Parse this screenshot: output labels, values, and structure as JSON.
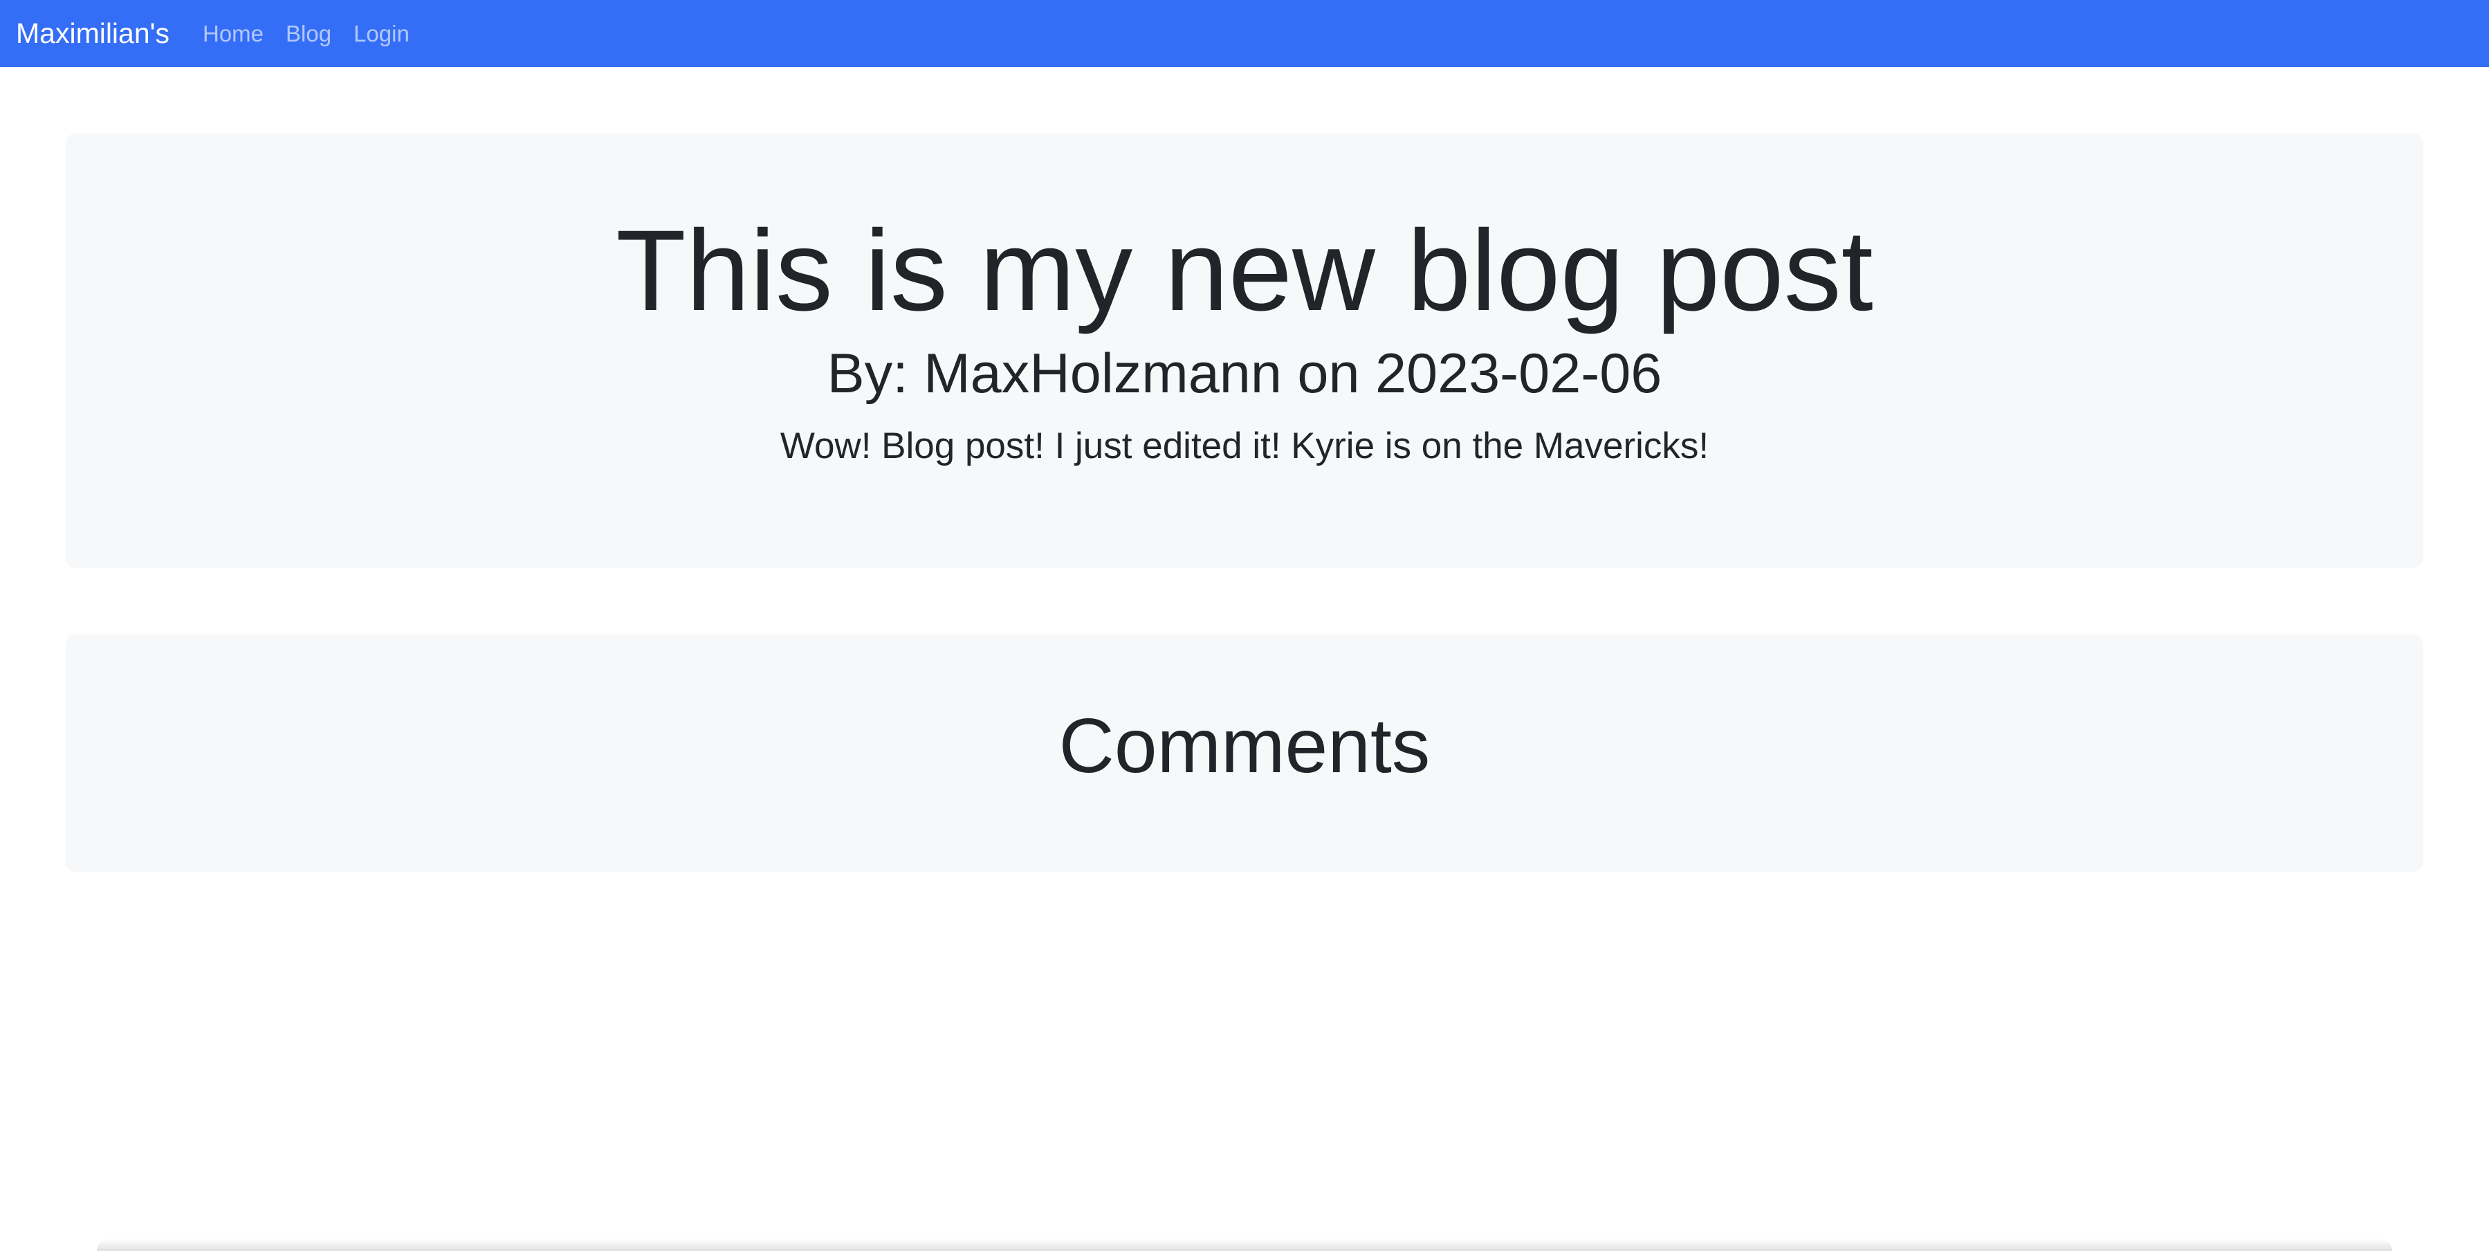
{
  "navbar": {
    "brand": "Maximilian's",
    "links": [
      {
        "label": "Home"
      },
      {
        "label": "Blog"
      },
      {
        "label": "Login"
      }
    ],
    "background_color": "#356ef6"
  },
  "post": {
    "title": "This is my new blog post",
    "byline": "By: MaxHolzmann on 2023-02-06",
    "body": "Wow! Blog post! I just edited it! Kyrie is on the Mavericks!"
  },
  "comments": {
    "heading": "Comments"
  },
  "colors": {
    "panel_background": "#f7f8fa",
    "text": "#212529"
  }
}
